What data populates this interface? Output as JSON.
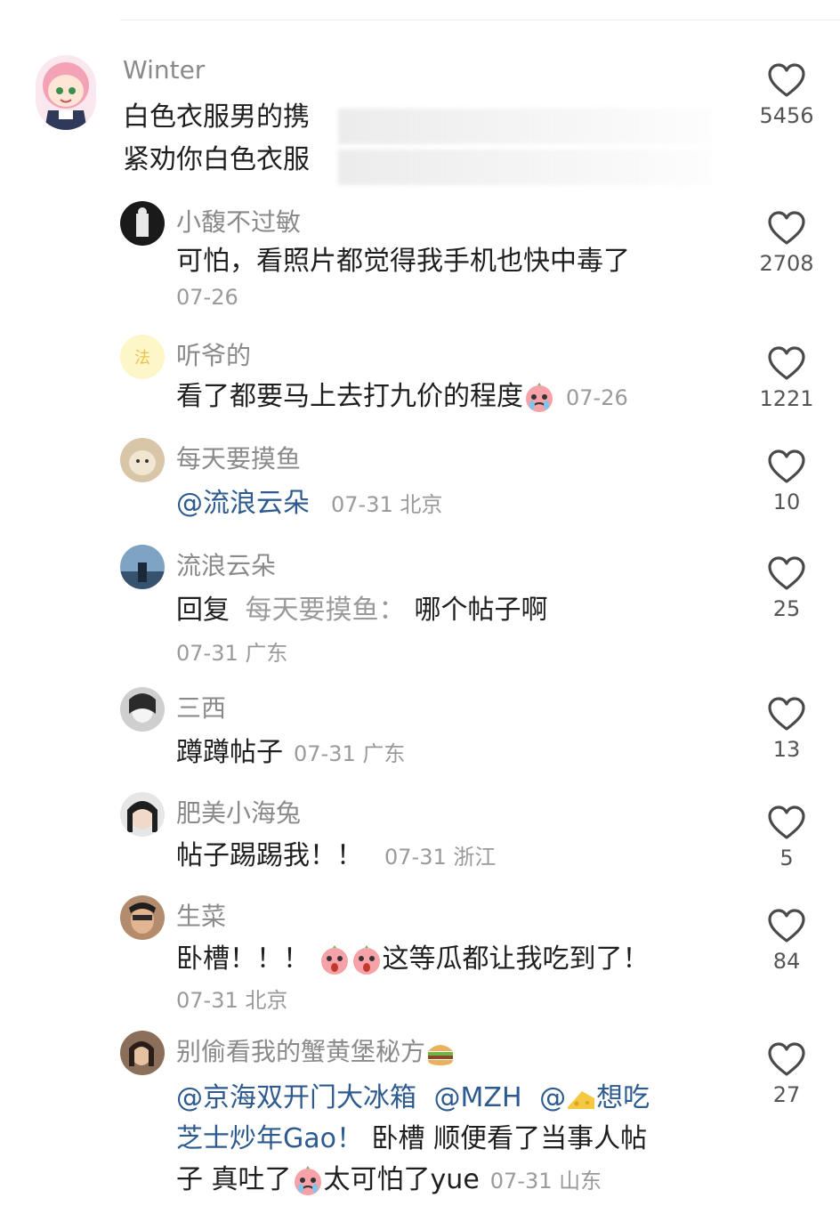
{
  "comments": [
    {
      "name": "Winter",
      "line1": "白色衣服男的携",
      "line2": "紧劝你白色衣服",
      "likes": "5456"
    },
    {
      "name": "小馥不过敏",
      "text": "可怕，看照片都觉得我手机也快中毒了",
      "meta": "07-26",
      "likes": "2708"
    },
    {
      "name": "听爷的",
      "text": "看了都要马上去打九价的程度",
      "meta": "07-26",
      "likes": "1221"
    },
    {
      "name": "每天要摸鱼",
      "mention": "@流浪云朵",
      "meta": "07-31 北京",
      "likes": "10"
    },
    {
      "name": "流浪云朵",
      "reply_prefix": "回复",
      "reply_to": "每天要摸鱼：",
      "text": "哪个帖子啊",
      "meta": "07-31 广东",
      "likes": "25"
    },
    {
      "name": "三西",
      "text": "蹲蹲帖子",
      "meta": "07-31 广东",
      "likes": "13"
    },
    {
      "name": "肥美小海兔",
      "text": "帖子踢踢我！！",
      "meta": "07-31 浙江",
      "likes": "5"
    },
    {
      "name": "生菜",
      "text_a": "卧槽！！！",
      "text_b": "这等瓜都让我吃到了！",
      "meta": "07-31 北京",
      "likes": "84"
    },
    {
      "name": "别偷看我的蟹黄堡秘方",
      "mention_a": "@京海双开门大冰箱",
      "mention_b": "@MZH",
      "mention_c": "@",
      "mention_c2": "想吃",
      "line2_mention": "芝士炒年Gao！",
      "line2_text": " 卧槽 顺便看了当事人帖",
      "line3_a": "子 真吐了",
      "line3_b": "太可怕了yue",
      "meta": "07-31 山东",
      "likes": "27"
    }
  ],
  "icons": {
    "like": "heart-outline-icon"
  },
  "colors": {
    "mention": "#2e5b8f",
    "name": "#8a8a8a",
    "meta": "#9a9a9a"
  }
}
